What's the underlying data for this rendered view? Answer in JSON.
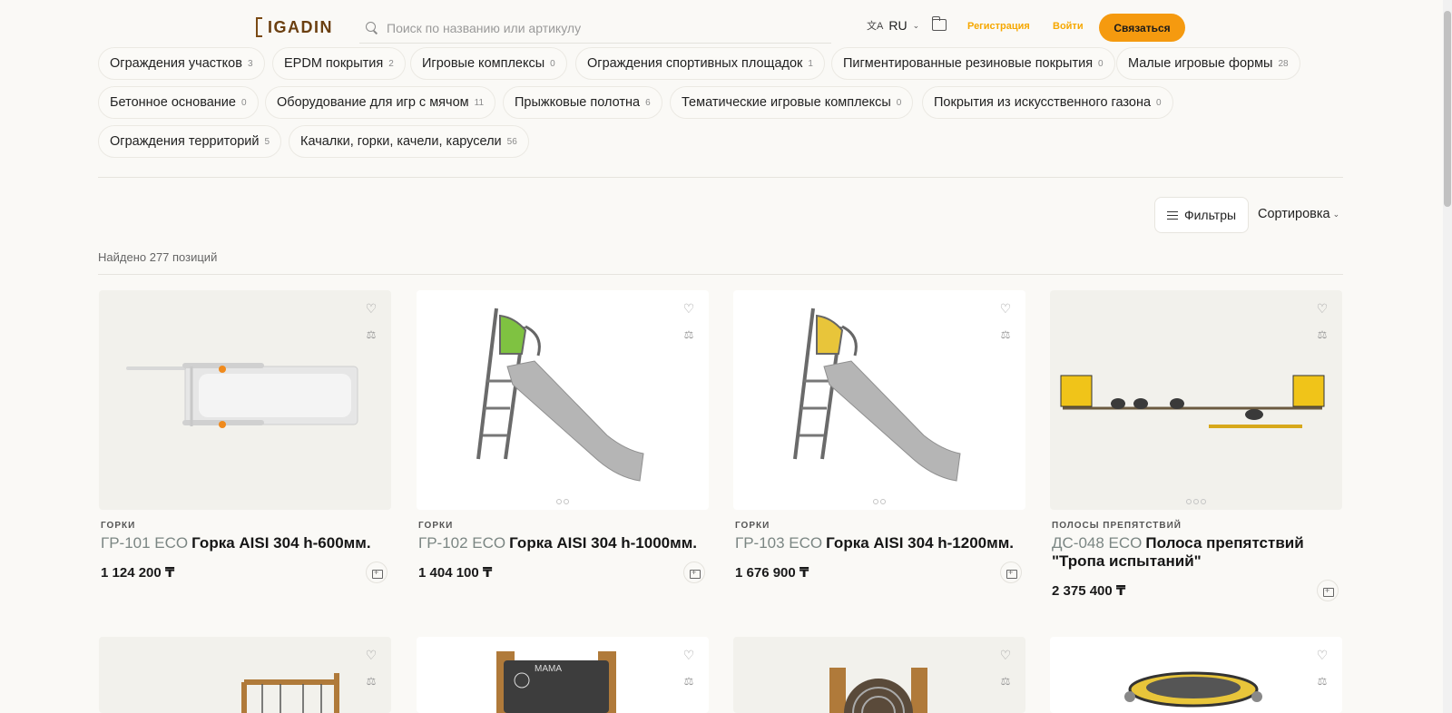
{
  "header": {
    "logo_text": "IGADIN",
    "search_placeholder": "Поиск по названию или артикулу",
    "lang": "RU",
    "register": "Регистрация",
    "login": "Войти",
    "contact": "Связаться"
  },
  "categories": [
    {
      "label": "Ограждения участков",
      "count": "3"
    },
    {
      "label": "EPDM покрытия",
      "count": "2"
    },
    {
      "label": "Игровые комплексы",
      "count": "0"
    },
    {
      "label": "Ограждения спортивных площадок",
      "count": "1"
    },
    {
      "label": "Пигментированные резиновые покрытия",
      "count": "0"
    },
    {
      "label": "Малые игровые формы",
      "count": "28"
    },
    {
      "label": "Бетонное основание",
      "count": "0"
    },
    {
      "label": "Оборудование для игр с мячом",
      "count": "11"
    },
    {
      "label": "Прыжковые полотна",
      "count": "6"
    },
    {
      "label": "Тематические игровые комплексы",
      "count": "0"
    },
    {
      "label": "Покрытия из искусственного газона",
      "count": "0"
    },
    {
      "label": "Ограждения территорий",
      "count": "5"
    },
    {
      "label": "Качалки, горки, качели, карусели",
      "count": "56"
    }
  ],
  "toolbar": {
    "filters": "Фильтры",
    "sort": "Сортировка",
    "found": "Найдено 277 позиций"
  },
  "products": [
    {
      "category": "ГОРКИ",
      "sku": "ГР-101 ECO",
      "name": "Горка AISI 304 h-600мм.",
      "price": "1 124 200 ₸"
    },
    {
      "category": "ГОРКИ",
      "sku": "ГР-102 ECO",
      "name": "Горка AISI 304 h-1000мм.",
      "price": "1 404 100 ₸"
    },
    {
      "category": "ГОРКИ",
      "sku": "ГР-103 ECO",
      "name": "Горка AISI 304 h-1200мм.",
      "price": "1 676 900 ₸"
    },
    {
      "category": "ПОЛОСЫ ПРЕПЯТСТВИЙ",
      "sku": "ДС-048 ECO",
      "name": "Полоса препятствий \"Тропа испытаний\"",
      "price": "2 375 400 ₸"
    }
  ],
  "board_texts": {
    "mama": "МАМА"
  },
  "colors": {
    "accent": "#f59a0f",
    "link": "#f6a800",
    "slide_green": "#7fc241",
    "slide_yellow": "#e8c53a"
  }
}
